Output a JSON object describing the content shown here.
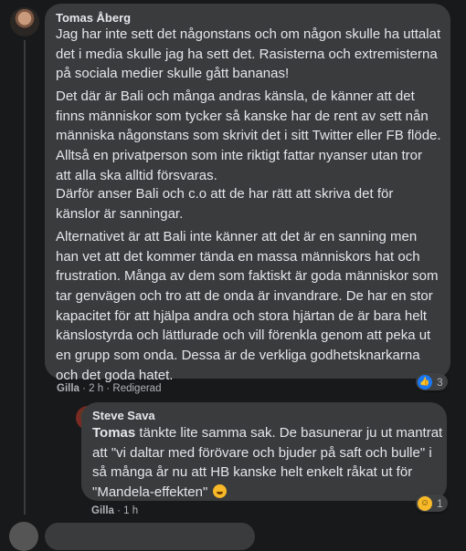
{
  "comment1": {
    "author": "Tomas Åberg",
    "paragraphs": [
      [
        "Jag har inte sett det någonstans och om någon skulle ha uttalat",
        "det i media skulle jag ha sett det. Rasisterna och extremisterna",
        "på sociala medier skulle gått bananas!"
      ],
      [
        "Det där är Bali och många andras känsla, de känner att det",
        "finns människor som tycker så kanske har de rent av sett nån",
        "människa någonstans som skrivit det i sitt Twitter eller FB flöde.",
        "Alltså en privatperson som inte riktigt fattar nyanser utan tror",
        "att alla ska alltid försvaras."
      ],
      [
        "Därför anser Bali och c.o att de har rätt att skriva det för",
        "känslor är sanningar."
      ],
      [
        "Alternativet är att Bali inte känner att det är en sanning men",
        "han vet att det kommer tända en massa människors hat och",
        "frustration. Många av dem som faktiskt är goda människor som",
        "tar genvägen och tro att de onda är invandrare. De har en stor",
        "kapacitet för att hjälpa andra och stora hjärtan de är bara helt",
        "känslostyrda och lättlurade och vill förenkla genom att peka ut",
        "en grupp som onda. Dessa är de verkliga godhetsknarkarna",
        "och det goda hatet."
      ]
    ],
    "action": "Gilla",
    "time": "2 h",
    "edited": "Redigerad",
    "reaction_count": "3",
    "reaction_icon": "like-icon"
  },
  "comment2": {
    "author": "Steve Sava",
    "mention": "Tomas",
    "lines": [
      " tänkte lite samma sak. De basunerar ju ut mantrat",
      "att \"vi daltar med förövare och bjuder på saft och bulle\" i",
      "så många år nu att HB kanske helt enkelt råkat ut för",
      "\"Mandela-effekten\""
    ],
    "action": "Gilla",
    "time": "1 h",
    "reaction_count": "1",
    "reaction_icon": "haha-icon"
  },
  "colors": {
    "background": "#18191a",
    "bubble": "#3a3b3c",
    "text": "#e4e6eb",
    "meta": "#b0b3b8",
    "like": "#1877f2",
    "haha": "#f7b928"
  }
}
